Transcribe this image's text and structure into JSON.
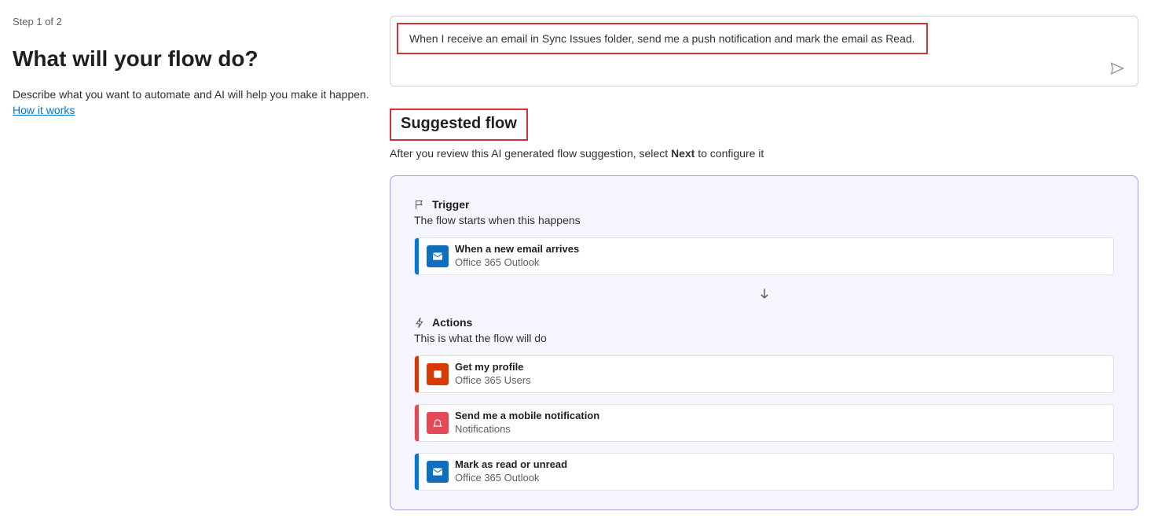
{
  "step": "Step 1 of 2",
  "heading": "What will your flow do?",
  "description": "Describe what you want to automate and AI will help you make it happen.",
  "how_it_works_link": "How it works",
  "prompt_text": "When I receive an email in Sync Issues folder, send me a push notification and mark the email as Read.",
  "suggested": {
    "title": "Suggested flow",
    "subtitle_pre": "After you review this AI generated flow suggestion, select ",
    "subtitle_bold": "Next",
    "subtitle_post": " to configure it"
  },
  "trigger": {
    "label": "Trigger",
    "sub": "The flow starts when this happens",
    "card": {
      "title": "When a new email arrives",
      "connector": "Office 365 Outlook"
    }
  },
  "actions": {
    "label": "Actions",
    "sub": "This is what the flow will do",
    "items": [
      {
        "title": "Get my profile",
        "connector": "Office 365 Users"
      },
      {
        "title": "Send me a mobile notification",
        "connector": "Notifications"
      },
      {
        "title": "Mark as read or unread",
        "connector": "Office 365 Outlook"
      }
    ]
  }
}
